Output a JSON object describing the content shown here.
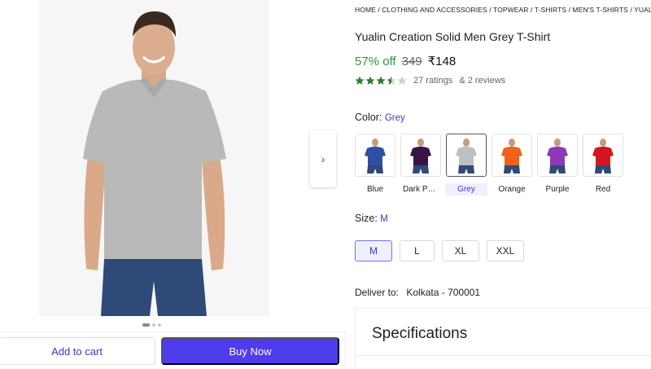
{
  "gallery": {
    "next_icon": "chevron-right-icon",
    "dots": 3,
    "active_dot": 0
  },
  "actions": {
    "add_to_cart": "Add to cart",
    "buy_now": "Buy Now",
    "buy_color": "#4f3ced"
  },
  "breadcrumb": [
    "HOME",
    "CLOTHING AND ACCESSORIES",
    "TOPWEAR",
    "T-SHIRTS",
    "MEN'S T-SHIRTS",
    "YUALIN CR"
  ],
  "product": {
    "title": "Yualin Creation Solid Men Grey T-Shirt",
    "discount": "57% off",
    "mrp": "349",
    "price": "₹148",
    "rating_value": 3.5,
    "ratings": "27 ratings",
    "reviews": "& 2 reviews"
  },
  "color": {
    "label": "Color:",
    "selected": "Grey",
    "options": [
      {
        "name": "Blue",
        "hex": "#2e4fa3"
      },
      {
        "name": "Dark Pu...",
        "hex": "#3b1446"
      },
      {
        "name": "Grey",
        "hex": "#c0c0c0"
      },
      {
        "name": "Orange",
        "hex": "#f0611a"
      },
      {
        "name": "Purple",
        "hex": "#8e3ab6"
      },
      {
        "name": "Red",
        "hex": "#d4161f"
      }
    ]
  },
  "size": {
    "label": "Size:",
    "selected": "M",
    "options": [
      "M",
      "L",
      "XL",
      "XXL"
    ]
  },
  "delivery": {
    "label": "Deliver to:",
    "location": "Kolkata - 700001"
  },
  "specifications": {
    "heading": "Specifications"
  },
  "colors": {
    "accent": "#4534c9",
    "discount": "#2b9b43",
    "star": "#2e7d32"
  }
}
